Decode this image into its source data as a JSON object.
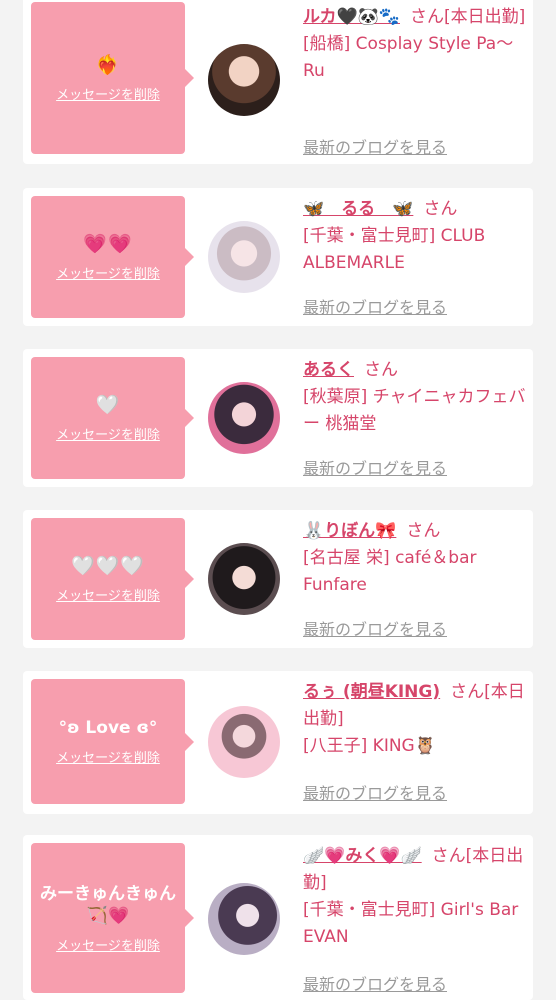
{
  "delete_label": "メッセージを削除",
  "blog_label": "最新のブログを見る",
  "honorific": "さん",
  "cards": [
    {
      "message": "❤️‍🔥",
      "name": "ルカ🖤🐼🐾",
      "status": "[本日出勤]",
      "shop": "[船橋] Cosplay Style Pa〜Ru"
    },
    {
      "message": "💗💗",
      "name": "🦋　るる　🦋",
      "status": "",
      "shop": "[千葉・富士見町] CLUB ALBEMARLE"
    },
    {
      "message": "🤍",
      "name": "あるく",
      "status": "",
      "shop": "[秋葉原] チャイニャカフェバー 桃猫堂"
    },
    {
      "message": "🤍🤍🤍",
      "name": "🐰りぼん🎀",
      "status": "",
      "shop": "[名古屋 栄] café＆bar Funfare"
    },
    {
      "message": "°ʚ Love ɞ°",
      "name": "るぅ (朝昼KING)",
      "status": "[本日出勤]",
      "shop": "[八王子] KING🦉"
    },
    {
      "message": "みーきゅんきゅん🏹💗",
      "name": "🪽💗みく💗🪽",
      "status": "[本日出勤]",
      "shop": "[千葉・富士見町] Girl's Bar EVAN"
    }
  ],
  "colors": {
    "bubble": "#f79eae",
    "accent": "#d6456a",
    "link_gray": "#9a9a9a",
    "page_bg": "#f3f3f3"
  }
}
